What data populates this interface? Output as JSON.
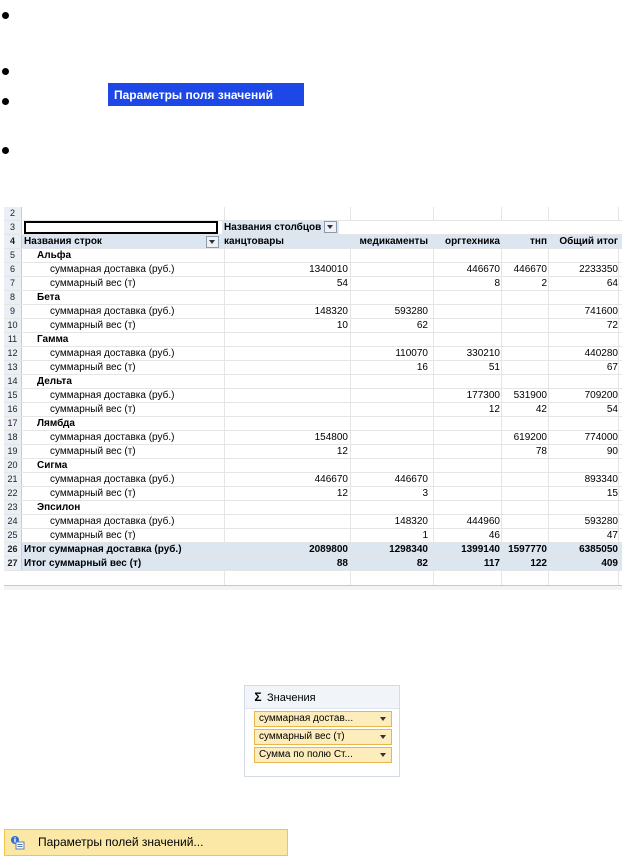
{
  "params_title": "Параметры поля значений",
  "pivot": {
    "column_area_label": "Названия столбцов",
    "row_area_label": "Названия строк",
    "columns": [
      "канцтовары",
      "медикаменты",
      "оргтехника",
      "тнп",
      "Общий итог"
    ],
    "rows": [
      {
        "n": "5",
        "label": "Альфа",
        "type": "group",
        "vals": [
          "",
          "",
          "",
          "",
          ""
        ]
      },
      {
        "n": "6",
        "label": "суммарная доставка (руб.)",
        "type": "item",
        "vals": [
          "1340010",
          "",
          "446670",
          "446670",
          "2233350"
        ]
      },
      {
        "n": "7",
        "label": "суммарный вес (т)",
        "type": "item",
        "vals": [
          "54",
          "",
          "8",
          "2",
          "64"
        ]
      },
      {
        "n": "8",
        "label": "Бета",
        "type": "group",
        "vals": [
          "",
          "",
          "",
          "",
          ""
        ]
      },
      {
        "n": "9",
        "label": "суммарная доставка (руб.)",
        "type": "item",
        "vals": [
          "148320",
          "593280",
          "",
          "",
          "741600"
        ]
      },
      {
        "n": "10",
        "label": "суммарный вес (т)",
        "type": "item",
        "vals": [
          "10",
          "62",
          "",
          "",
          "72"
        ]
      },
      {
        "n": "11",
        "label": "Гамма",
        "type": "group",
        "vals": [
          "",
          "",
          "",
          "",
          ""
        ]
      },
      {
        "n": "12",
        "label": "суммарная доставка (руб.)",
        "type": "item",
        "vals": [
          "",
          "110070",
          "330210",
          "",
          "440280"
        ]
      },
      {
        "n": "13",
        "label": "суммарный вес (т)",
        "type": "item",
        "vals": [
          "",
          "16",
          "51",
          "",
          "67"
        ]
      },
      {
        "n": "14",
        "label": "Дельта",
        "type": "group",
        "vals": [
          "",
          "",
          "",
          "",
          ""
        ]
      },
      {
        "n": "15",
        "label": "суммарная доставка (руб.)",
        "type": "item",
        "vals": [
          "",
          "",
          "177300",
          "531900",
          "709200"
        ]
      },
      {
        "n": "16",
        "label": "суммарный вес (т)",
        "type": "item",
        "vals": [
          "",
          "",
          "12",
          "42",
          "54"
        ]
      },
      {
        "n": "17",
        "label": "Лямбда",
        "type": "group",
        "vals": [
          "",
          "",
          "",
          "",
          ""
        ]
      },
      {
        "n": "18",
        "label": "суммарная доставка (руб.)",
        "type": "item",
        "vals": [
          "154800",
          "",
          "",
          "619200",
          "774000"
        ]
      },
      {
        "n": "19",
        "label": "суммарный вес (т)",
        "type": "item",
        "vals": [
          "12",
          "",
          "",
          "78",
          "90"
        ]
      },
      {
        "n": "20",
        "label": "Сигма",
        "type": "group",
        "vals": [
          "",
          "",
          "",
          "",
          ""
        ]
      },
      {
        "n": "21",
        "label": "суммарная доставка (руб.)",
        "type": "item",
        "vals": [
          "446670",
          "446670",
          "",
          "",
          "893340"
        ]
      },
      {
        "n": "22",
        "label": "суммарный вес (т)",
        "type": "item",
        "vals": [
          "12",
          "3",
          "",
          "",
          "15"
        ]
      },
      {
        "n": "23",
        "label": "Эпсилон",
        "type": "group",
        "vals": [
          "",
          "",
          "",
          "",
          ""
        ]
      },
      {
        "n": "24",
        "label": "суммарная доставка (руб.)",
        "type": "item",
        "vals": [
          "",
          "148320",
          "444960",
          "",
          "593280"
        ]
      },
      {
        "n": "25",
        "label": "суммарный вес (т)",
        "type": "item",
        "vals": [
          "",
          "1",
          "46",
          "",
          "47"
        ]
      },
      {
        "n": "26",
        "label": "Итог суммарная доставка (руб.)",
        "type": "total",
        "vals": [
          "2089800",
          "1298340",
          "1399140",
          "1597770",
          "6385050"
        ]
      },
      {
        "n": "27",
        "label": "Итог суммарный вес (т)",
        "type": "total",
        "vals": [
          "88",
          "82",
          "117",
          "122",
          "409"
        ]
      }
    ]
  },
  "values_panel": {
    "header": "Значения",
    "items": [
      "суммарная достав...",
      "суммарный вес (т)",
      "Сумма по полю Ст..."
    ]
  },
  "menu": {
    "label": "Параметры полей значений..."
  }
}
